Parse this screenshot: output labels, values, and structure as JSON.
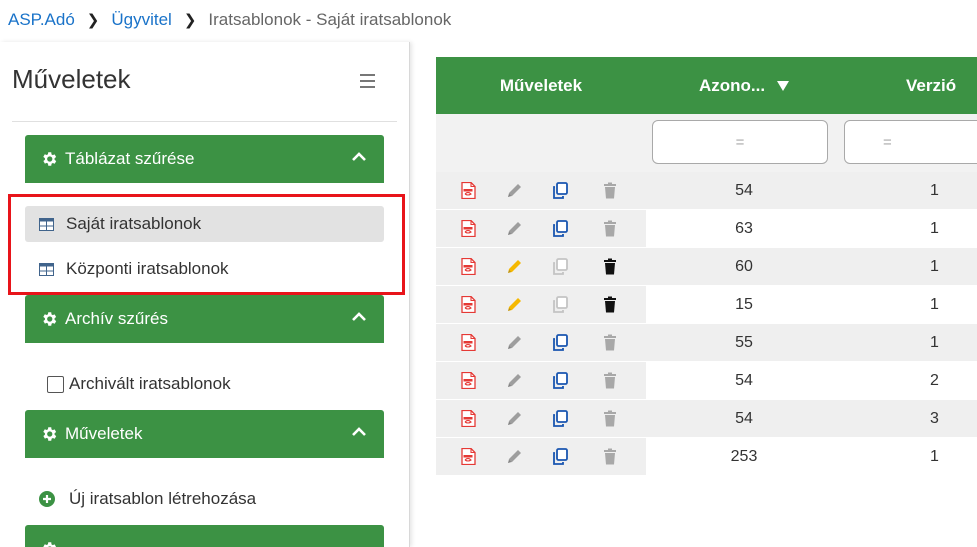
{
  "breadcrumb": {
    "items": [
      "ASP.Adó",
      "Ügyvitel"
    ],
    "current": "Iratsablonok - Saját iratsablonok"
  },
  "sidebar": {
    "title": "Műveletek",
    "panels": [
      {
        "title": "Táblázat szűrése",
        "items": [
          "Saját iratsablonok",
          "Központi iratsablonok"
        ],
        "selected": "Saját iratsablonok"
      },
      {
        "title": "Archív szűrés",
        "items": [
          "Archivált iratsablonok"
        ]
      },
      {
        "title": "Műveletek",
        "items": [
          "Új iratsablon létrehozása"
        ]
      }
    ]
  },
  "table": {
    "columns": [
      "Műveletek",
      "Azono...",
      "Verzió"
    ],
    "filter_placeholder": "=",
    "rows": [
      {
        "azonosito": "54",
        "verzio": "1",
        "editable": false
      },
      {
        "azonosito": "63",
        "verzio": "1",
        "editable": false
      },
      {
        "azonosito": "60",
        "verzio": "1",
        "editable": true
      },
      {
        "azonosito": "15",
        "verzio": "1",
        "editable": true
      },
      {
        "azonosito": "55",
        "verzio": "1",
        "editable": false
      },
      {
        "azonosito": "54",
        "verzio": "2",
        "editable": false
      },
      {
        "azonosito": "54",
        "verzio": "3",
        "editable": false
      },
      {
        "azonosito": "253",
        "verzio": "1",
        "editable": false
      }
    ]
  },
  "colors": {
    "accent_green": "#3c9244",
    "link_blue": "#1a73c9",
    "highlight_red": "#e8141a",
    "pdf_red": "#e53935",
    "edit_yellow": "#f5b800",
    "copy_blue": "#1a56b0"
  },
  "icons": [
    "gear-icon",
    "chevron-up-icon",
    "table-grid-icon",
    "checkbox-icon",
    "plus-circle-icon",
    "menu-icon",
    "sort-down-icon",
    "pdf-icon",
    "pencil-icon",
    "copy-icon",
    "trash-icon"
  ]
}
